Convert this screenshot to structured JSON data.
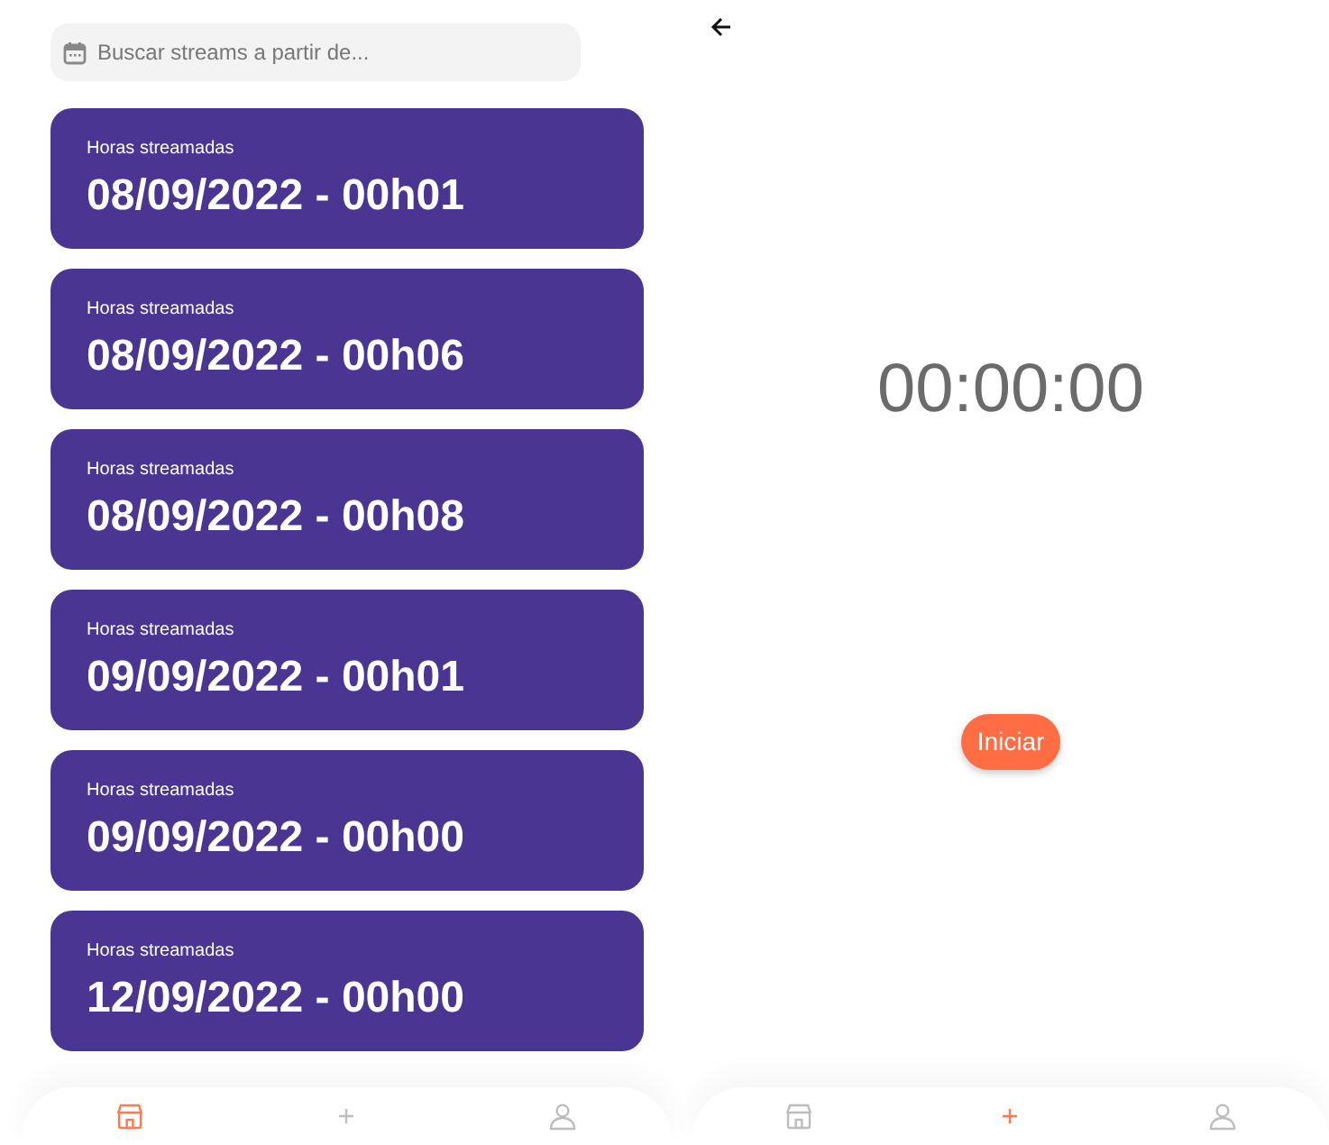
{
  "streams_screen": {
    "search": {
      "placeholder": "Buscar streams a partir de..."
    },
    "streams": [
      {
        "label": "Horas streamadas",
        "value": "08/09/2022 - 00h01"
      },
      {
        "label": "Horas streamadas",
        "value": "08/09/2022 - 00h06"
      },
      {
        "label": "Horas streamadas",
        "value": "08/09/2022 - 00h08"
      },
      {
        "label": "Horas streamadas",
        "value": "09/09/2022 - 00h01"
      },
      {
        "label": "Horas streamadas",
        "value": "09/09/2022 - 00h00"
      },
      {
        "label": "Horas streamadas",
        "value": "12/09/2022 - 00h00"
      }
    ],
    "nav": [
      {
        "kind": "store",
        "selected": true
      },
      {
        "kind": "add",
        "selected": false
      },
      {
        "kind": "profile",
        "selected": false
      }
    ]
  },
  "timer_screen": {
    "timer": "00:00:00",
    "button": "Iniciar",
    "nav": [
      {
        "kind": "store",
        "selected": false
      },
      {
        "kind": "add",
        "selected": true
      },
      {
        "kind": "profile",
        "selected": false
      }
    ]
  }
}
